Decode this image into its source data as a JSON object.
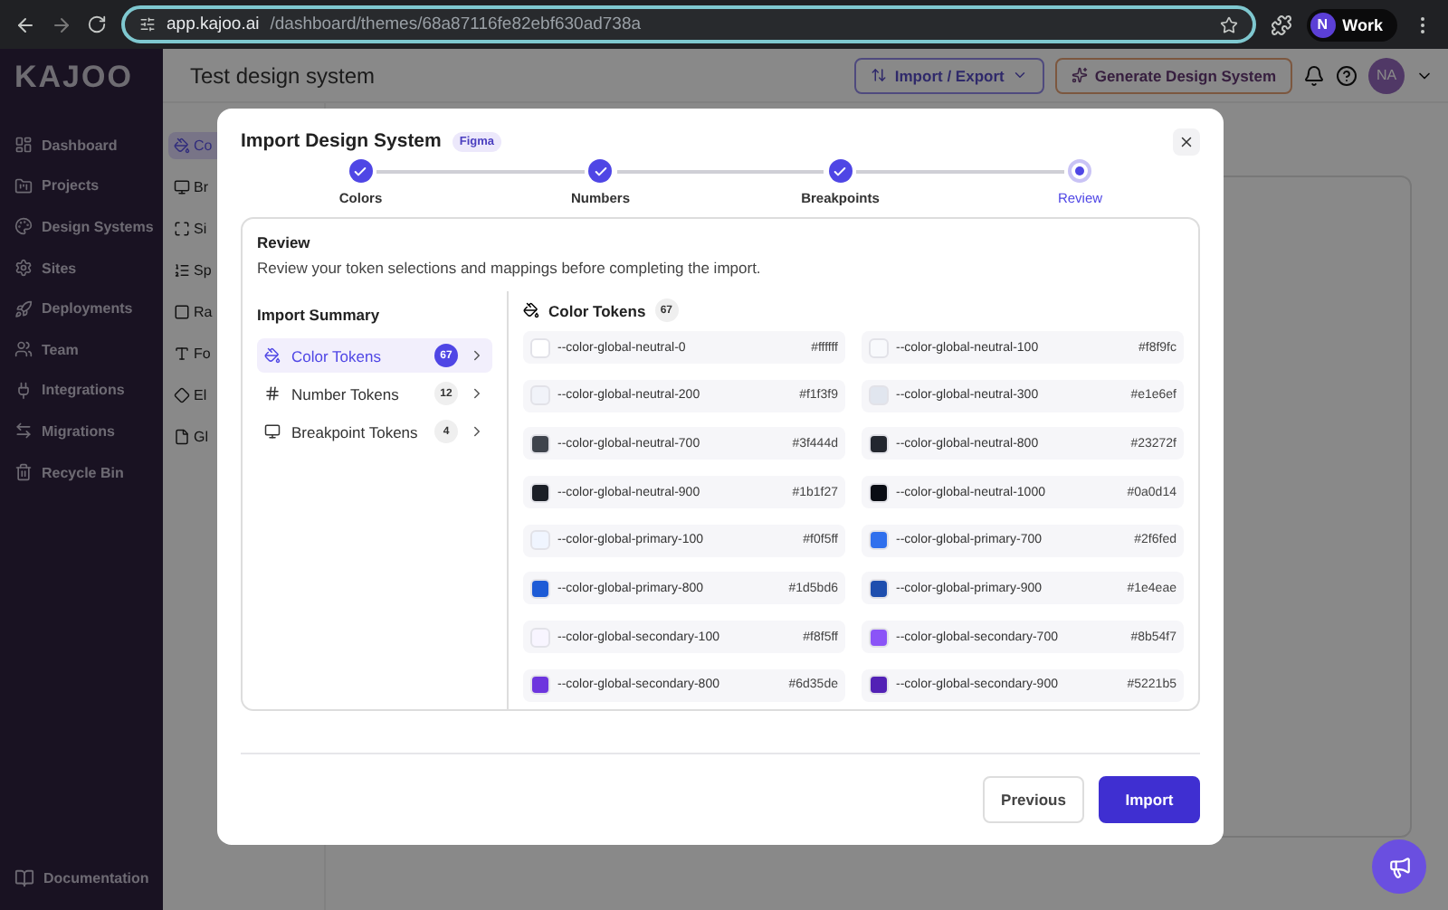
{
  "browser": {
    "url_host": "app.kajoo.ai",
    "url_path": "/dashboard/themes/68a87116fe82ebf630ad738a",
    "profile_initial": "N",
    "profile_name": "Work"
  },
  "logo": "KAJOO",
  "sidebar": {
    "items": [
      {
        "label": "Dashboard"
      },
      {
        "label": "Projects"
      },
      {
        "label": "Design Systems"
      },
      {
        "label": "Sites"
      },
      {
        "label": "Deployments"
      },
      {
        "label": "Team"
      },
      {
        "label": "Integrations"
      },
      {
        "label": "Migrations"
      },
      {
        "label": "Recycle Bin"
      }
    ],
    "footer": "Documentation"
  },
  "subnav": [
    {
      "label": "Co",
      "selected": true
    },
    {
      "label": "Br",
      "selected": false
    },
    {
      "label": "Si",
      "selected": false
    },
    {
      "label": "Sp",
      "selected": false
    },
    {
      "label": "Ra",
      "selected": false
    },
    {
      "label": "Fo",
      "selected": false
    },
    {
      "label": "El",
      "selected": false
    },
    {
      "label": "Gl",
      "selected": false
    }
  ],
  "header": {
    "title": "Test design system",
    "import_export": "Import / Export",
    "generate": "Generate Design System",
    "avatar": "NA"
  },
  "modal": {
    "title": "Import Design System",
    "badge": "Figma",
    "steps": [
      {
        "label": "Colors",
        "completed": true,
        "selected": false
      },
      {
        "label": "Numbers",
        "completed": true,
        "selected": false
      },
      {
        "label": "Breakpoints",
        "completed": true,
        "selected": false
      },
      {
        "label": "Review",
        "completed": false,
        "selected": true
      }
    ],
    "review_title": "Review",
    "review_text": "Review your token selections and mappings before completing the import.",
    "summary_title": "Import Summary",
    "summary": [
      {
        "label": "Color Tokens",
        "count": "67",
        "selected": true
      },
      {
        "label": "Number Tokens",
        "count": "12",
        "selected": false
      },
      {
        "label": "Breakpoint Tokens",
        "count": "4",
        "selected": false
      }
    ],
    "tokens_title": "Color Tokens",
    "tokens_count": "67",
    "tokens": [
      {
        "name": "--color-global-neutral-0",
        "value": "#ffffff",
        "color": "#ffffff"
      },
      {
        "name": "--color-global-neutral-100",
        "value": "#f8f9fc",
        "color": "#f8f9fc"
      },
      {
        "name": "--color-global-neutral-200",
        "value": "#f1f3f9",
        "color": "#f1f3f9"
      },
      {
        "name": "--color-global-neutral-300",
        "value": "#e1e6ef",
        "color": "#e1e6ef"
      },
      {
        "name": "--color-global-neutral-700",
        "value": "#3f444d",
        "color": "#3f444d"
      },
      {
        "name": "--color-global-neutral-800",
        "value": "#23272f",
        "color": "#23272f"
      },
      {
        "name": "--color-global-neutral-900",
        "value": "#1b1f27",
        "color": "#1b1f27"
      },
      {
        "name": "--color-global-neutral-1000",
        "value": "#0a0d14",
        "color": "#0a0d14"
      },
      {
        "name": "--color-global-primary-100",
        "value": "#f0f5ff",
        "color": "#f0f5ff"
      },
      {
        "name": "--color-global-primary-700",
        "value": "#2f6fed",
        "color": "#2f6fed"
      },
      {
        "name": "--color-global-primary-800",
        "value": "#1d5bd6",
        "color": "#1d5bd6"
      },
      {
        "name": "--color-global-primary-900",
        "value": "#1e4eae",
        "color": "#1e4eae"
      },
      {
        "name": "--color-global-secondary-100",
        "value": "#f8f5ff",
        "color": "#f8f5ff"
      },
      {
        "name": "--color-global-secondary-700",
        "value": "#8b54f7",
        "color": "#8b54f7"
      },
      {
        "name": "--color-global-secondary-800",
        "value": "#6d35de",
        "color": "#6d35de"
      },
      {
        "name": "--color-global-secondary-900",
        "value": "#5221b5",
        "color": "#5221b5"
      }
    ],
    "buttons": {
      "previous": "Previous",
      "import": "Import"
    }
  }
}
